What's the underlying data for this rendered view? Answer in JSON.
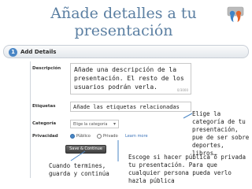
{
  "header": {
    "title": "Añade detalles a tu presentación"
  },
  "step_bar": {
    "badge": "1",
    "label": "Add Details"
  },
  "form": {
    "description": {
      "label": "Descripción",
      "value": "Añade una descripción de la presentación. El resto de los usuarios podrán verla.",
      "char_count": "0/3000"
    },
    "tags": {
      "label": "Etiquetas",
      "value": "Añade las etiquetas relacionadas"
    },
    "category": {
      "label": "Categoría",
      "selected": "Elige la categoría"
    },
    "privacy": {
      "label": "Privacidad",
      "options": [
        "Público",
        "Privado"
      ],
      "learn_more": "Learn more"
    },
    "save_button": "Save & Continue"
  },
  "callouts": {
    "category_note": "Elige la categoría de tu presentación, pue de ser sobre deportes, libros…",
    "privacy_note": "Escoge si hacer pública o privada tu presentación. Para que cualquier persona pueda verlo hazla pública",
    "save_note": "Cuando termines, guarda y continúa"
  },
  "colors": {
    "title": "#5b7fa2",
    "accent": "#4a86c5",
    "callout_line": "#4a86c5"
  },
  "icons": {
    "brand": "slideshare-logo-icon",
    "step": "step-number-badge",
    "category_dropdown": "chevron-down-icon",
    "privacy": "radio-button-icon"
  }
}
